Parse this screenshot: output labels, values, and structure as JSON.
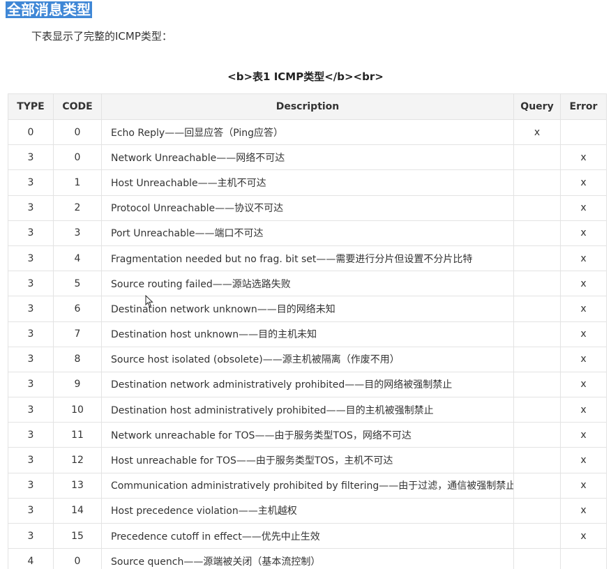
{
  "heading": "全部消息类型",
  "intro": "下表显示了完整的ICMP类型：",
  "caption": "<b>表1 ICMP类型</b><br>",
  "table": {
    "headers": {
      "type": "TYPE",
      "code": "CODE",
      "description": "Description",
      "query": "Query",
      "error": "Error"
    },
    "rows": [
      {
        "type": "0",
        "code": "0",
        "description": "Echo Reply——回显应答（Ping应答）",
        "query": "x",
        "error": ""
      },
      {
        "type": "3",
        "code": "0",
        "description": "Network Unreachable——网络不可达",
        "query": "",
        "error": "x"
      },
      {
        "type": "3",
        "code": "1",
        "description": "Host Unreachable——主机不可达",
        "query": "",
        "error": "x"
      },
      {
        "type": "3",
        "code": "2",
        "description": "Protocol Unreachable——协议不可达",
        "query": "",
        "error": "x"
      },
      {
        "type": "3",
        "code": "3",
        "description": "Port Unreachable——端口不可达",
        "query": "",
        "error": "x"
      },
      {
        "type": "3",
        "code": "4",
        "description": "Fragmentation needed but no frag. bit set——需要进行分片但设置不分片比特",
        "query": "",
        "error": "x"
      },
      {
        "type": "3",
        "code": "5",
        "description": "Source routing failed——源站选路失败",
        "query": "",
        "error": "x"
      },
      {
        "type": "3",
        "code": "6",
        "description": "Destination network unknown——目的网络未知",
        "query": "",
        "error": "x"
      },
      {
        "type": "3",
        "code": "7",
        "description": "Destination host unknown——目的主机未知",
        "query": "",
        "error": "x"
      },
      {
        "type": "3",
        "code": "8",
        "description": "Source host isolated (obsolete)——源主机被隔离（作废不用）",
        "query": "",
        "error": "x"
      },
      {
        "type": "3",
        "code": "9",
        "description": "Destination network administratively prohibited——目的网络被强制禁止",
        "query": "",
        "error": "x"
      },
      {
        "type": "3",
        "code": "10",
        "description": "Destination host administratively prohibited——目的主机被强制禁止",
        "query": "",
        "error": "x"
      },
      {
        "type": "3",
        "code": "11",
        "description": "Network unreachable for TOS——由于服务类型TOS，网络不可达",
        "query": "",
        "error": "x"
      },
      {
        "type": "3",
        "code": "12",
        "description": "Host unreachable for TOS——由于服务类型TOS，主机不可达",
        "query": "",
        "error": "x"
      },
      {
        "type": "3",
        "code": "13",
        "description": "Communication administratively prohibited by filtering——由于过滤，通信被强制禁止",
        "query": "",
        "error": "x"
      },
      {
        "type": "3",
        "code": "14",
        "description": "Host precedence violation——主机越权",
        "query": "",
        "error": "x"
      },
      {
        "type": "3",
        "code": "15",
        "description": "Precedence cutoff in effect——优先中止生效",
        "query": "",
        "error": "x"
      },
      {
        "type": "4",
        "code": "0",
        "description": "Source quench——源端被关闭（基本流控制）",
        "query": "",
        "error": ""
      }
    ]
  }
}
